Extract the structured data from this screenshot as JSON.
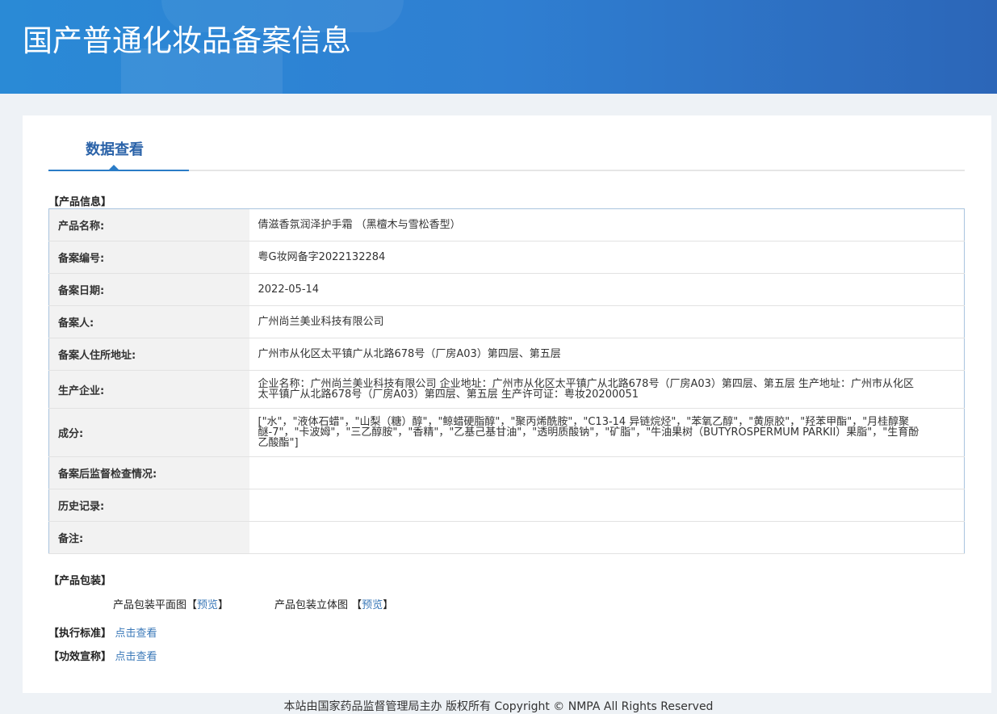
{
  "header": {
    "title": "国产普通化妆品备案信息"
  },
  "tab": {
    "label": "数据查看"
  },
  "product_info": {
    "section_label": "【产品信息】",
    "rows": [
      {
        "label": "产品名称:",
        "value": "倩滋香氛润泽护手霜 （黑檀木与雪松香型）"
      },
      {
        "label": "备案编号:",
        "value": "粤G妆网备字2022132284"
      },
      {
        "label": "备案日期:",
        "value": "2022-05-14"
      },
      {
        "label": "备案人:",
        "value": "广州尚兰美业科技有限公司"
      },
      {
        "label": "备案人住所地址:",
        "value": "广州市从化区太平镇广从北路678号（厂房A03）第四层、第五层"
      },
      {
        "label": "生产企业:",
        "value": "企业名称：广州尚兰美业科技有限公司 企业地址：广州市从化区太平镇广从北路678号（厂房A03）第四层、第五层 生产地址：广州市从化区太平镇广从北路678号（厂房A03）第四层、第五层 生产许可证：粤妆20200051"
      },
      {
        "label": "成分:",
        "value": "[\"水\"，\"液体石蜡\"，\"山梨（糖）醇\"，\"鲸蜡硬脂醇\"，\"聚丙烯酰胺\"，\"C13-14 异链烷烃\"，\"苯氧乙醇\"，\"黄原胶\"，\"羟苯甲酯\"，\"月桂醇聚醚-7\"，\"卡波姆\"，\"三乙醇胺\"，\"香精\"，\"乙基己基甘油\"，\"透明质酸钠\"，\"矿脂\"，\"牛油果树（BUTYROSPERMUM PARKII）果脂\"，\"生育酚乙酸酯\"]"
      },
      {
        "label": "备案后监督检查情况:",
        "value": ""
      },
      {
        "label": "历史记录:",
        "value": ""
      },
      {
        "label": "备注:",
        "value": ""
      }
    ]
  },
  "packaging": {
    "section_label": "【产品包装】",
    "flat_label": "产品包装平面图",
    "stereo_label": "产品包装立体图",
    "bracket_open": "【",
    "bracket_close": "】",
    "preview": "预览"
  },
  "standard": {
    "label": "【执行标准】",
    "link": "点击查看"
  },
  "efficacy": {
    "label": "【功效宣称】",
    "link": "点击查看"
  },
  "footer": {
    "text": "本站由国家药品监督管理局主办 版权所有 Copyright © NMPA All Rights Reserved"
  }
}
